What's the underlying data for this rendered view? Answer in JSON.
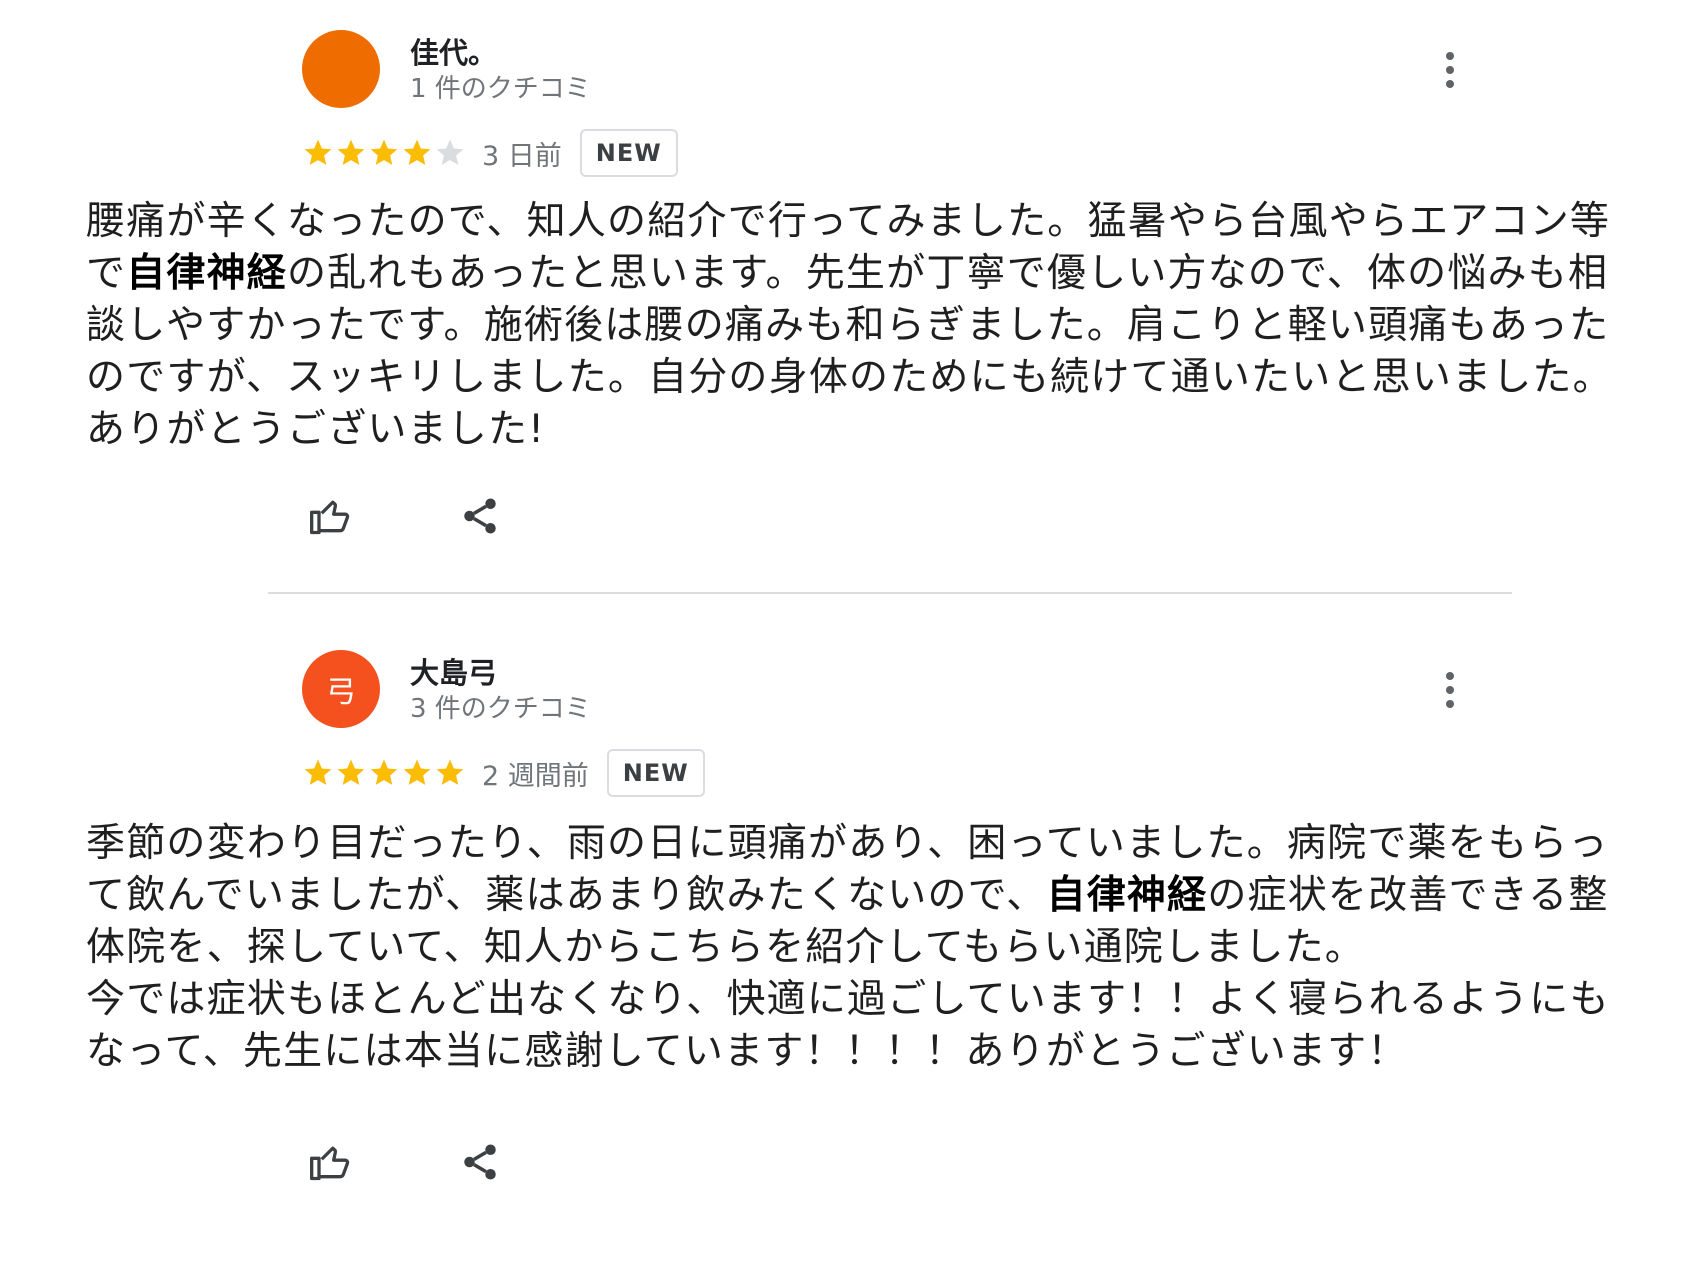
{
  "colors": {
    "star_filled": "#fbbc04",
    "star_empty": "#dadce0",
    "avatar_1": "#ef6c00",
    "avatar_2": "#f4511e",
    "divider": "#dadce0"
  },
  "reviews": [
    {
      "name": "佳代。",
      "avatar_letter": "",
      "review_count": "1 件のクチコミ",
      "rating": 4,
      "max_rating": 5,
      "time": "3 日前",
      "badge": "NEW",
      "text_parts": [
        {
          "text": "腰痛が辛くなったので、知人の紹介で行ってみました。猛暑やら台風やらエアコン等で",
          "bold": false
        },
        {
          "text": "自律神経",
          "bold": true
        },
        {
          "text": "の乱れもあったと思います。先生が丁寧で優しい方なので、体の悩みも相談しやすかったです。施術後は腰の痛みも和らぎました。肩こりと軽い頭痛もあったのですが、スッキリしました。自分の身体のためにも続けて通いたいと思いました。ありがとうございました!",
          "bold": false
        }
      ],
      "like_icon": "thumbs-up-icon",
      "share_icon": "share-icon"
    },
    {
      "name": "大島弓",
      "avatar_letter": "弓",
      "review_count": "3 件のクチコミ",
      "rating": 5,
      "max_rating": 5,
      "time": "2 週間前",
      "badge": "NEW",
      "text_parts": [
        {
          "text": "季節の変わり目だったり、雨の日に頭痛があり、困っていました。病院で薬をもらって飲んでいましたが、薬はあまり飲みたくないので、",
          "bold": false
        },
        {
          "text": "自律神経",
          "bold": true
        },
        {
          "text": "の症状を改善できる整体院を、探していて、知人からこちらを紹介してもらい通院しました。\n今では症状もほとんど出なくなり、快適に過ごしています！！よく寝られるようにもなって、先生には本当に感謝しています！！！！ありがとうございます！",
          "bold": false
        }
      ],
      "like_icon": "thumbs-up-icon",
      "share_icon": "share-icon"
    }
  ]
}
